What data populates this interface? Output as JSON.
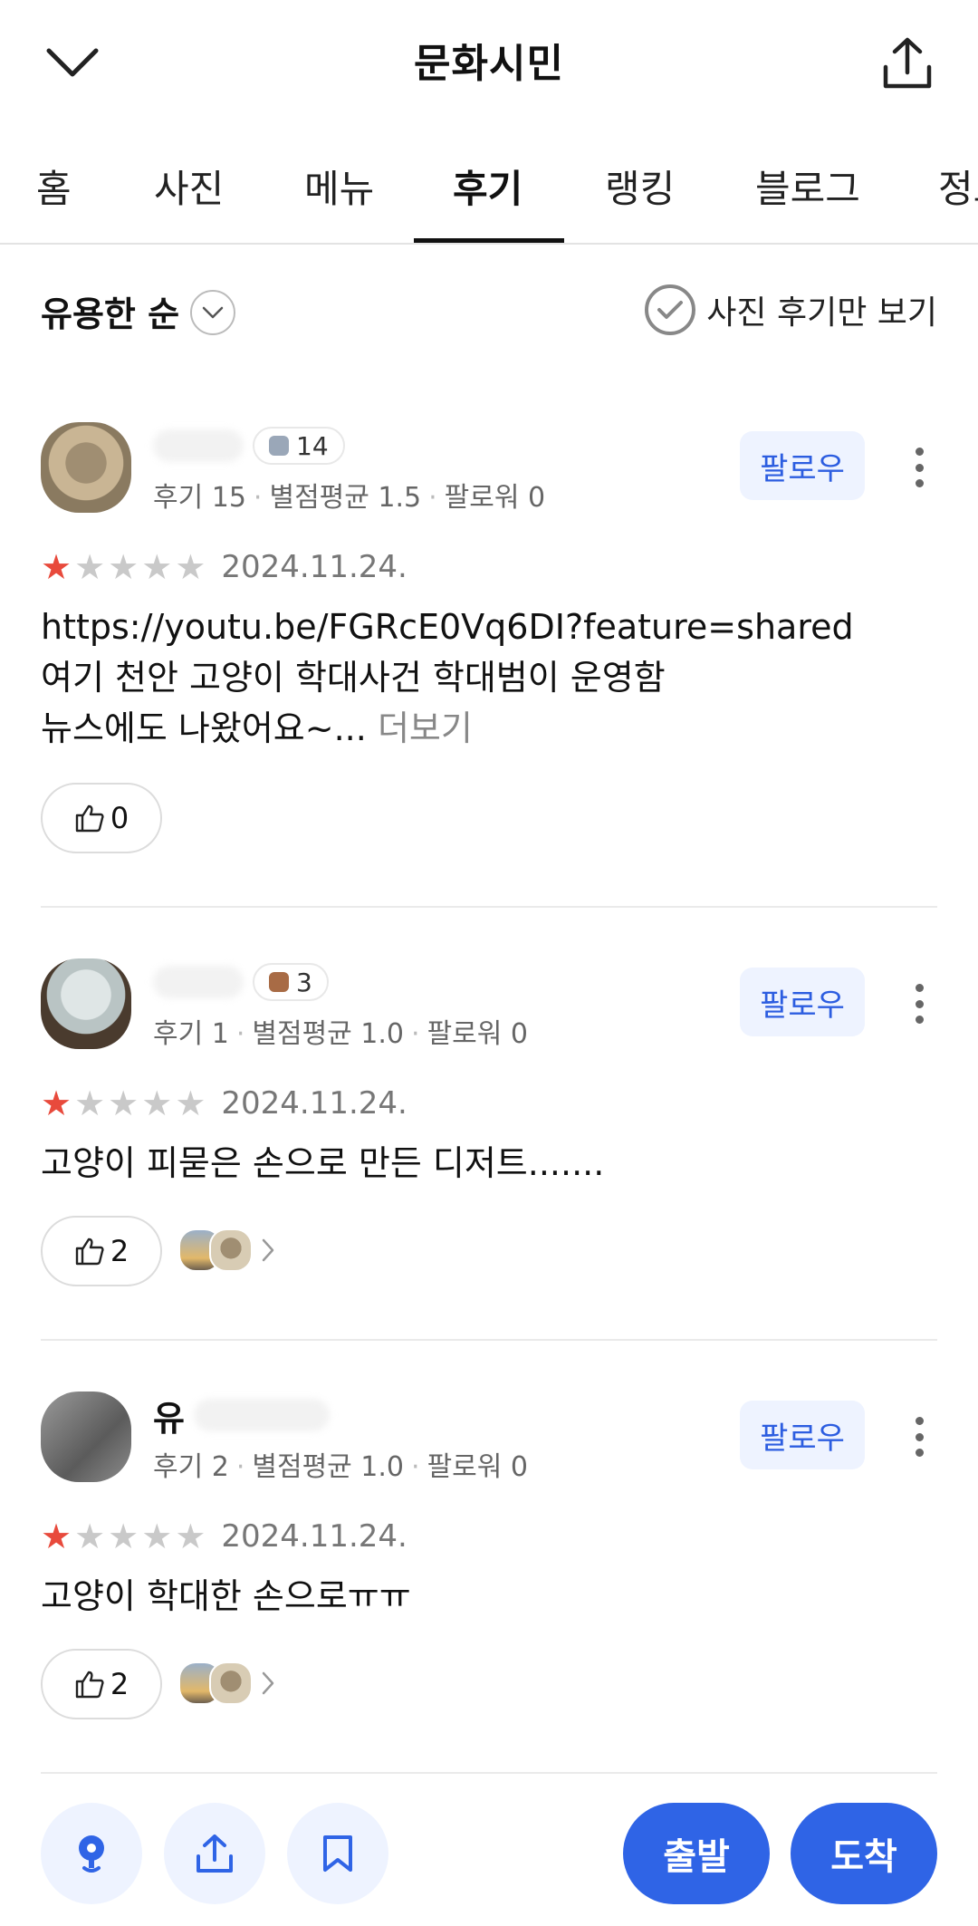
{
  "header": {
    "title": "문화시민"
  },
  "tabs": [
    {
      "label": "홈"
    },
    {
      "label": "사진"
    },
    {
      "label": "메뉴"
    },
    {
      "label": "후기"
    },
    {
      "label": "랭킹"
    },
    {
      "label": "블로그"
    },
    {
      "label": "정보"
    }
  ],
  "active_tab": "후기",
  "sort": {
    "label": "유용한 순",
    "photo_only_label": "사진 후기만 보기"
  },
  "reviews": [
    {
      "name": "",
      "level": "14",
      "meta": {
        "reviews": "후기 15",
        "avg": "별점평균 1.5",
        "followers": "팔로워 0"
      },
      "follow_label": "팔로우",
      "rating": 1,
      "date": "2024.11.24.",
      "lines": [
        "https://youtu.be/FGRcE0Vq6DI?feature=shared",
        "여기 천안 고양이 학대사건 학대범이 운영함",
        "뉴스에도 나왔어요~..."
      ],
      "more_label": "더보기",
      "likes": "0"
    },
    {
      "name": "",
      "level": "3",
      "meta": {
        "reviews": "후기 1",
        "avg": "별점평균 1.0",
        "followers": "팔로워 0"
      },
      "follow_label": "팔로우",
      "rating": 1,
      "date": "2024.11.24.",
      "lines": [
        "고양이 피묻은 손으로 만든 디저트......."
      ],
      "likes": "2"
    },
    {
      "name": "유",
      "level": "",
      "meta": {
        "reviews": "후기 2",
        "avg": "별점평균 1.0",
        "followers": "팔로워 0"
      },
      "follow_label": "팔로우",
      "rating": 1,
      "date": "2024.11.24.",
      "lines": [
        "고양이 학대한 손으로ㅠㅠ"
      ],
      "likes": "2"
    }
  ],
  "bottom": {
    "depart_label": "출발",
    "arrive_label": "도착"
  },
  "colors": {
    "accent": "#2f64e6",
    "star": "#e84a3c",
    "follow_bg": "#eef3ff"
  }
}
